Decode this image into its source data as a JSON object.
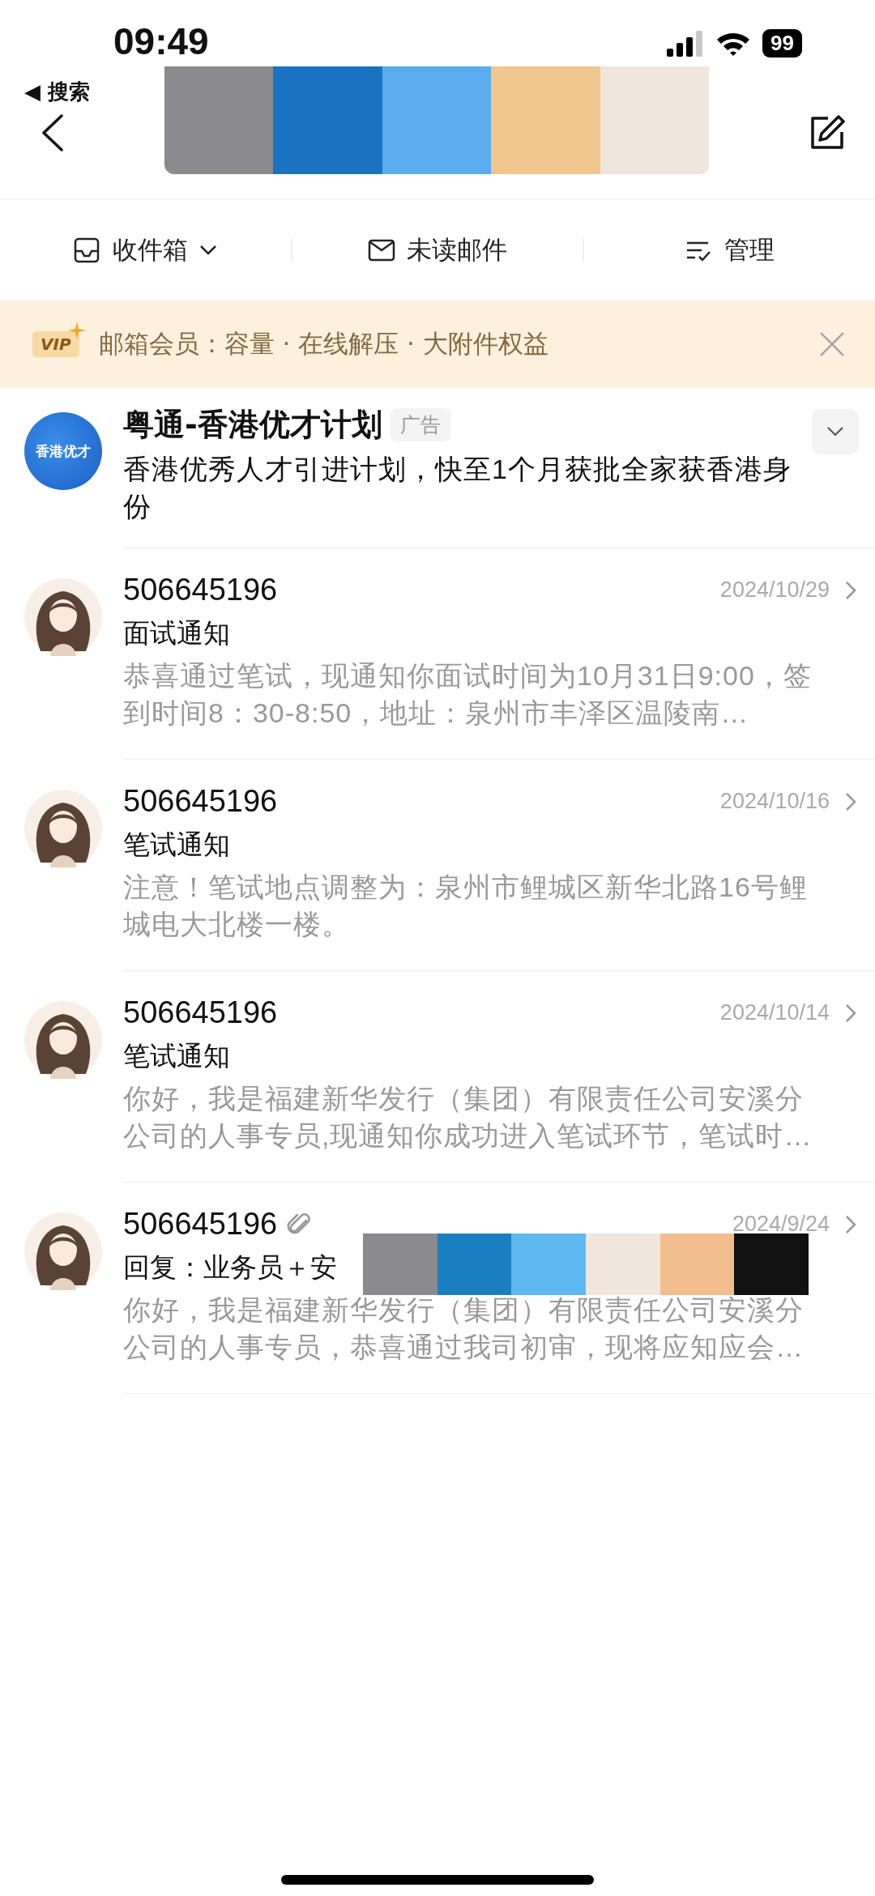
{
  "status_bar": {
    "time": "09:49",
    "back_app": "◀ 搜索",
    "battery": "99"
  },
  "title_redaction": {
    "segments": [
      {
        "color": "#8a8a8f"
      },
      {
        "color": "#1a72c2"
      },
      {
        "color": "#5aacef"
      },
      {
        "color": "#f0c68e"
      },
      {
        "color": "#f1e6dc"
      }
    ]
  },
  "toolbar": [
    {
      "kind": "inbox",
      "label": "收件箱",
      "dropdown": true
    },
    {
      "kind": "mail",
      "label": "未读邮件",
      "dropdown": false
    },
    {
      "kind": "manage",
      "label": "管理",
      "dropdown": false
    }
  ],
  "vip_banner": {
    "badge": "VIP",
    "text": "邮箱会员：容量 · 在线解压 · 大附件权益"
  },
  "ad": {
    "logo": "香港优才",
    "title": "粤通-香港优才计划",
    "tag": "广告",
    "description": "香港优秀人才引进计划，快至1个月获批全家获香港身份"
  },
  "emails": [
    {
      "sender": "506645196",
      "date": "2024/10/29",
      "subject": "面试通知",
      "preview": "恭喜通过笔试，现通知你面试时间为10月31日9:00，签到时间8：30-8:50，地址：泉州市丰泽区温陵南…",
      "attachment": false
    },
    {
      "sender": "506645196",
      "date": "2024/10/16",
      "subject": "笔试通知",
      "preview": "注意！笔试地点调整为：泉州市鲤城区新华北路16号鲤城电大北楼一楼。",
      "attachment": false
    },
    {
      "sender": "506645196",
      "date": "2024/10/14",
      "subject": "笔试通知",
      "preview": "你好，我是福建新华发行（集团）有限责任公司安溪分公司的人事专员,现通知你成功进入笔试环节，笔试时…",
      "attachment": false
    },
    {
      "sender": "506645196",
      "date": "2024/9/24",
      "subject": "回复：业务员＋安",
      "preview": "你好，我是福建新华发行（集团）有限责任公司安溪分公司的人事专员，恭喜通过我司初审，现将应知应会…",
      "attachment": true,
      "redaction": {
        "segments": [
          {
            "color": "#8a8a8f"
          },
          {
            "color": "#1a7fc1"
          },
          {
            "color": "#5db8f0"
          },
          {
            "color": "#f1e6dc"
          },
          {
            "color": "#f2bd8c"
          },
          {
            "color": "#111111"
          }
        ]
      }
    }
  ]
}
